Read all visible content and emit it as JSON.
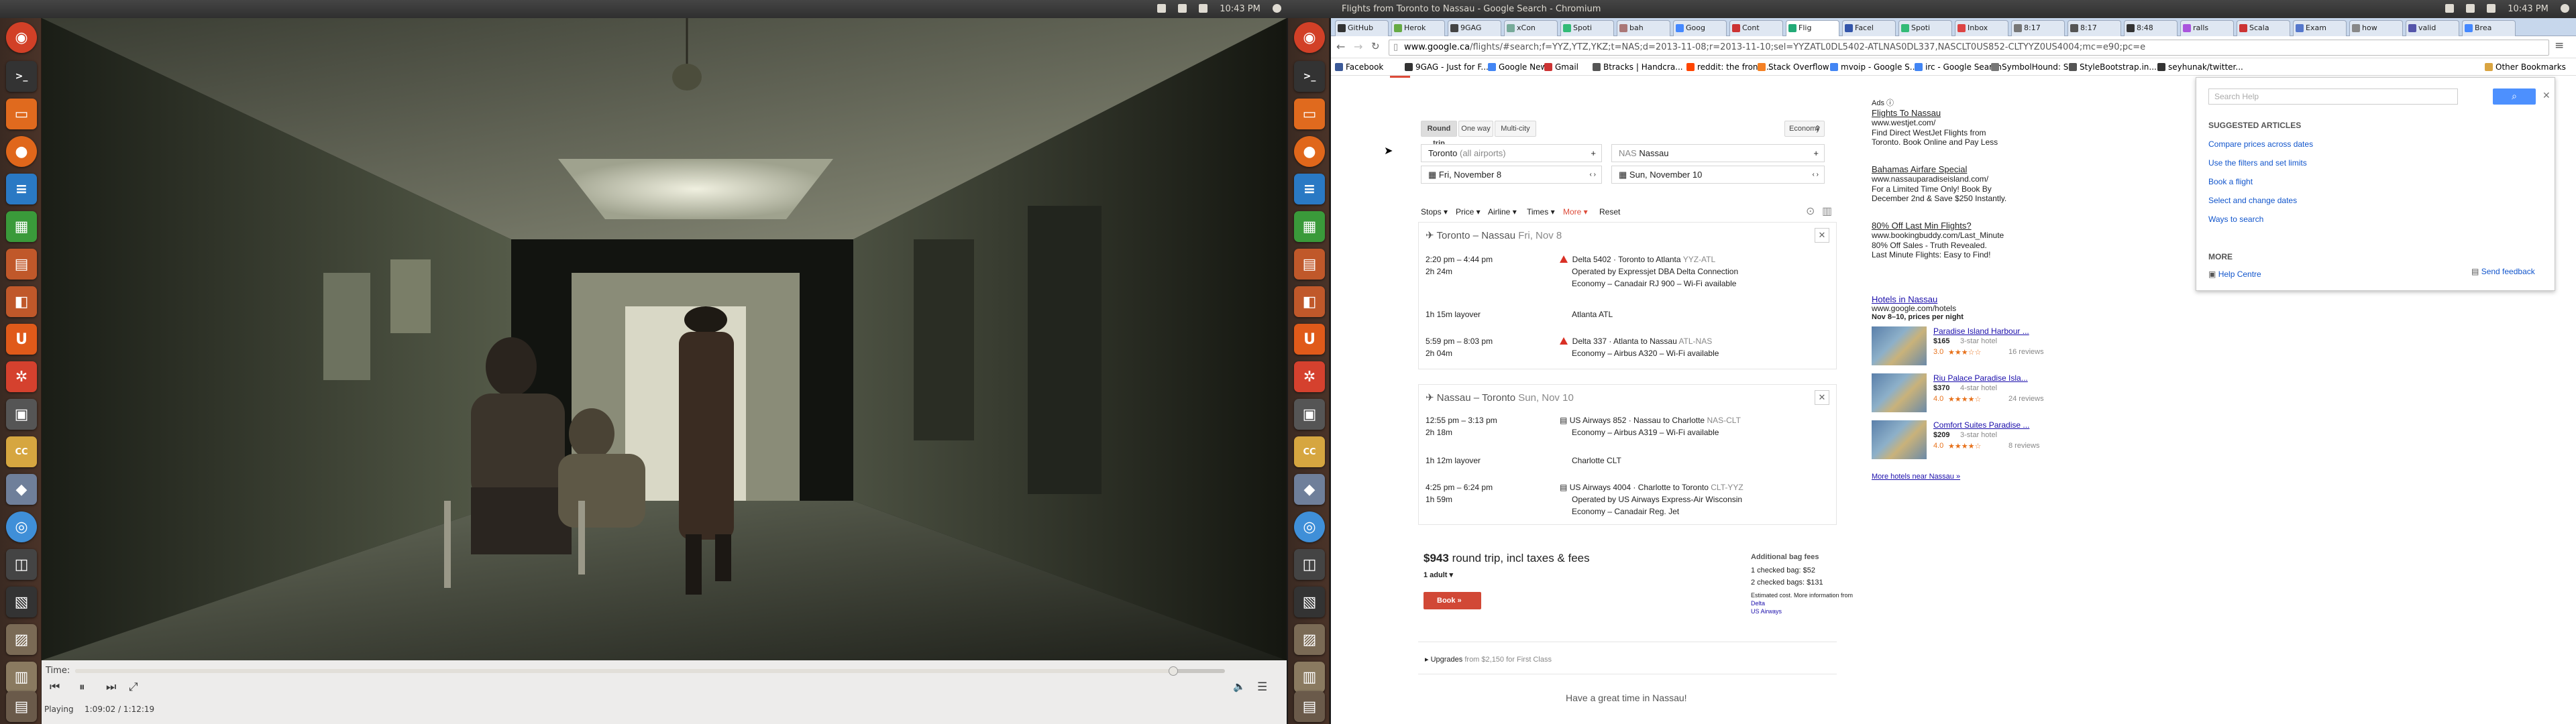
{
  "left_panel": {
    "title": "",
    "time": "10:43 PM"
  },
  "right_panel": {
    "title": "Flights from Toronto to Nassau - Google Search - Chromium",
    "time": "10:43 PM"
  },
  "player": {
    "time_label": "Time:",
    "status": "Playing",
    "position": "1:09:02 / 1:12:19",
    "progress": 0.955
  },
  "browser": {
    "tabs": [
      "GitHub",
      "Herok",
      "9GAG",
      "xCon",
      "Spoti",
      "bah",
      "Goog",
      "Cont",
      "Flig",
      "Facel",
      "Spoti",
      "Inbox",
      "8:17",
      "8:17",
      "8:48",
      "ralls",
      "Scala",
      "Exam",
      "how",
      "valid",
      "Brea"
    ],
    "active_tab": 8,
    "url_host": "www.google.ca",
    "url_path": "/flights/#search;f=YYZ,YTZ,YKZ;t=NAS;d=2013-11-08;r=2013-11-10;sel=YYZATL0DL5402-ATLNAS0DL337,NASCLT0US852-CLTYYZ0US4004;mc=e90;pc=e",
    "bookmarks": [
      "Facebook",
      "9GAG - Just for F...",
      "Google News",
      "Gmail",
      "Btracks | Handcra...",
      "reddit: the front ...",
      "Stack Overflow",
      "mvoip - Google S...",
      "irc - Google Search",
      "SymbolHound: S...",
      "StyleBootstrap.in...",
      "seyhunak/twitter...",
      "Other Bookmarks"
    ]
  },
  "flights": {
    "trip_types": [
      "Round trip",
      "One way",
      "Multi-city"
    ],
    "cabin": "Economy",
    "origin": "Toronto",
    "origin_sub": "(all airports)",
    "destination_code": "NAS",
    "destination": "Nassau",
    "depart_date": "Fri, November 8",
    "return_date": "Sun, November 10",
    "filters": [
      "Stops",
      "Price",
      "Airline",
      "Times",
      "More",
      "Reset"
    ],
    "outbound": {
      "route": "Toronto – Nassau",
      "date": "Fri, Nov 8",
      "seg1": {
        "times": "2:20 pm – 4:44 pm",
        "duration": "2h 24m",
        "title": "Delta 5402 · Toronto to Atlanta",
        "codes": "YYZ-ATL",
        "op": "Operated by Expressjet DBA Delta Connection",
        "equip": "Economy – Canadair RJ 900 – Wi-Fi available"
      },
      "layover": "1h 15m layover",
      "layover_city": "Atlanta ATL",
      "seg2": {
        "times": "5:59 pm – 8:03 pm",
        "duration": "2h 04m",
        "title": "Delta 337 · Atlanta to Nassau",
        "codes": "ATL-NAS",
        "equip": "Economy – Airbus A320 – Wi-Fi available"
      }
    },
    "return": {
      "route": "Nassau – Toronto",
      "date": "Sun, Nov 10",
      "seg1": {
        "times": "12:55 pm – 3:13 pm",
        "duration": "2h 18m",
        "title": "US Airways 852 · Nassau to Charlotte",
        "codes": "NAS-CLT",
        "equip": "Economy – Airbus A319 – Wi-Fi available"
      },
      "layover": "1h 12m layover",
      "layover_city": "Charlotte CLT",
      "seg2": {
        "times": "4:25 pm – 6:24 pm",
        "duration": "1h 59m",
        "title": "US Airways 4004 · Charlotte to Toronto",
        "codes": "CLT-YYZ",
        "op": "Operated by US Airways Express-Air Wisconsin",
        "equip": "Economy – Canadair Reg. Jet"
      }
    },
    "price": "$943",
    "price_text": "round trip, incl taxes & fees",
    "adults": "1 adult",
    "book": "Book »",
    "bag_title": "Additional bag fees",
    "bag1": "1 checked bag: $52",
    "bag2": "2 checked bags: $131",
    "bag_note": "Estimated cost. More information from",
    "bag_link": "Delta",
    "bag_link2": "US Airways",
    "upgrades": "Upgrades",
    "upgrades_text": "from $2,150 for First Class",
    "footer": "Have a great time in Nassau!"
  },
  "ads": {
    "label": "Ads",
    "items": [
      {
        "title": "Flights To Nassau",
        "url": "www.westjet.com/",
        "l1": "Find Direct WestJet Flights from",
        "l2": "Toronto. Book Online and Pay Less"
      },
      {
        "title": "Bahamas Airfare Special",
        "url": "www.nassauparadiseisland.com/",
        "l1": "For a Limited Time Only! Book By",
        "l2": "December 2nd & Save $250 Instantly."
      },
      {
        "title": "80% Off Last Min Flights?",
        "url": "www.bookingbuddy.com/Last_Minute",
        "l1": "80% Off Sales - Truth Revealed.",
        "l2": "Last Minute Flights: Easy to Find!"
      }
    ],
    "hotels_title": "Hotels in Nassau",
    "hotels_url": "www.google.com/hotels",
    "hotels_sub": "Nov 8–10, prices per night",
    "hotels": [
      {
        "name": "Paradise Island Harbour ...",
        "price": "$165",
        "cls": "3-star hotel",
        "rating": "3.0",
        "reviews": "16 reviews"
      },
      {
        "name": "Riu Palace Paradise Isla...",
        "price": "$370",
        "cls": "4-star hotel",
        "rating": "4.0",
        "reviews": "24 reviews"
      },
      {
        "name": "Comfort Suites Paradise ...",
        "price": "$209",
        "cls": "3-star hotel",
        "rating": "4.0",
        "reviews": "8 reviews"
      }
    ],
    "more_hotels": "More hotels near Nassau »"
  },
  "help": {
    "placeholder": "Search Help",
    "suggested": "SUGGESTED ARTICLES",
    "articles": [
      "Compare prices across dates",
      "Use the filters and set limits",
      "Book a flight",
      "Select and change dates",
      "Ways to search"
    ],
    "more": "MORE",
    "help_centre": "Help Centre",
    "feedback": "Send feedback"
  },
  "colors": {
    "accent": "#dd4b39",
    "link": "#1a0dab",
    "url_green": "#006621"
  }
}
